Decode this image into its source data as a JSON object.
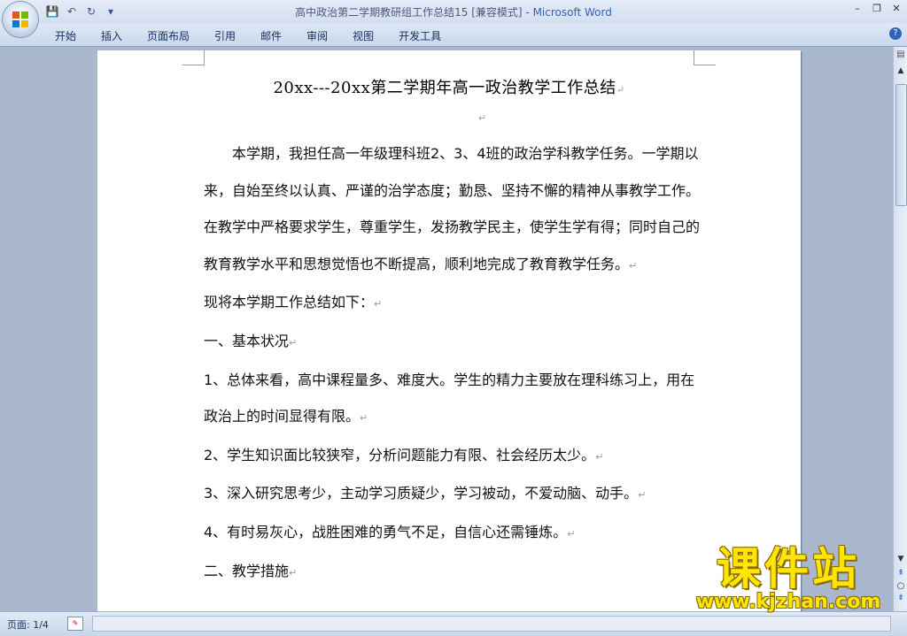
{
  "window": {
    "title": "高中政治第二学期教研组工作总结15 [兼容模式]",
    "app_name": "Microsoft Word",
    "separator": " - "
  },
  "qat": {
    "save_icon": "💾",
    "undo_icon": "↶",
    "redo_icon": "↻",
    "customize_icon": "▾"
  },
  "tabs": [
    "开始",
    "插入",
    "页面布局",
    "引用",
    "邮件",
    "审阅",
    "视图",
    "开发工具"
  ],
  "window_controls": {
    "minimize": "–",
    "restore": "❐",
    "close": "✕"
  },
  "help": "?",
  "document": {
    "title": "20xx---20xx第二学期年高一政治教学工作总结",
    "paragraph_mark": "↵",
    "paragraphs": [
      {
        "indent": true,
        "text": "本学期，我担任高一年级理科班2、3、4班的政治学科教学任务。一学期以来，自始至终以认真、严谨的治学态度；勤恳、坚持不懈的精神从事教学工作。在教学中严格要求学生，尊重学生，发扬教学民主，使学生学有得；同时自己的教育教学水平和思想觉悟也不断提高，顺利地完成了教育教学任务。"
      },
      {
        "indent": false,
        "text": "现将本学期工作总结如下："
      },
      {
        "indent": false,
        "text": "一、基本状况"
      },
      {
        "indent": false,
        "text": "1、总体来看，高中课程量多、难度大。学生的精力主要放在理科练习上，用在政治上的时间显得有限。"
      },
      {
        "indent": false,
        "text": "2、学生知识面比较狭窄，分析问题能力有限、社会经历太少。"
      },
      {
        "indent": false,
        "text": "3、深入研究思考少，主动学习质疑少，学习被动，不爱动脑、动手。"
      },
      {
        "indent": false,
        "text": "4、有时易灰心，战胜困难的勇气不足，自信心还需锤炼。"
      },
      {
        "indent": false,
        "text": "二、教学措施"
      }
    ]
  },
  "status": {
    "page_indicator": "页面: 1/4"
  },
  "watermark": {
    "text": "课件站",
    "url": "www.kjzhan.com"
  },
  "scrollbar": {
    "ruler_icon": "▤",
    "up": "▲",
    "down": "▼",
    "prev_page": "⇞",
    "browse_object": "○",
    "next_page": "⇟"
  },
  "colors": {
    "app_title": "#3162b8",
    "ribbon_bg": "#c9d7ec",
    "watermark": "#ffe600"
  }
}
